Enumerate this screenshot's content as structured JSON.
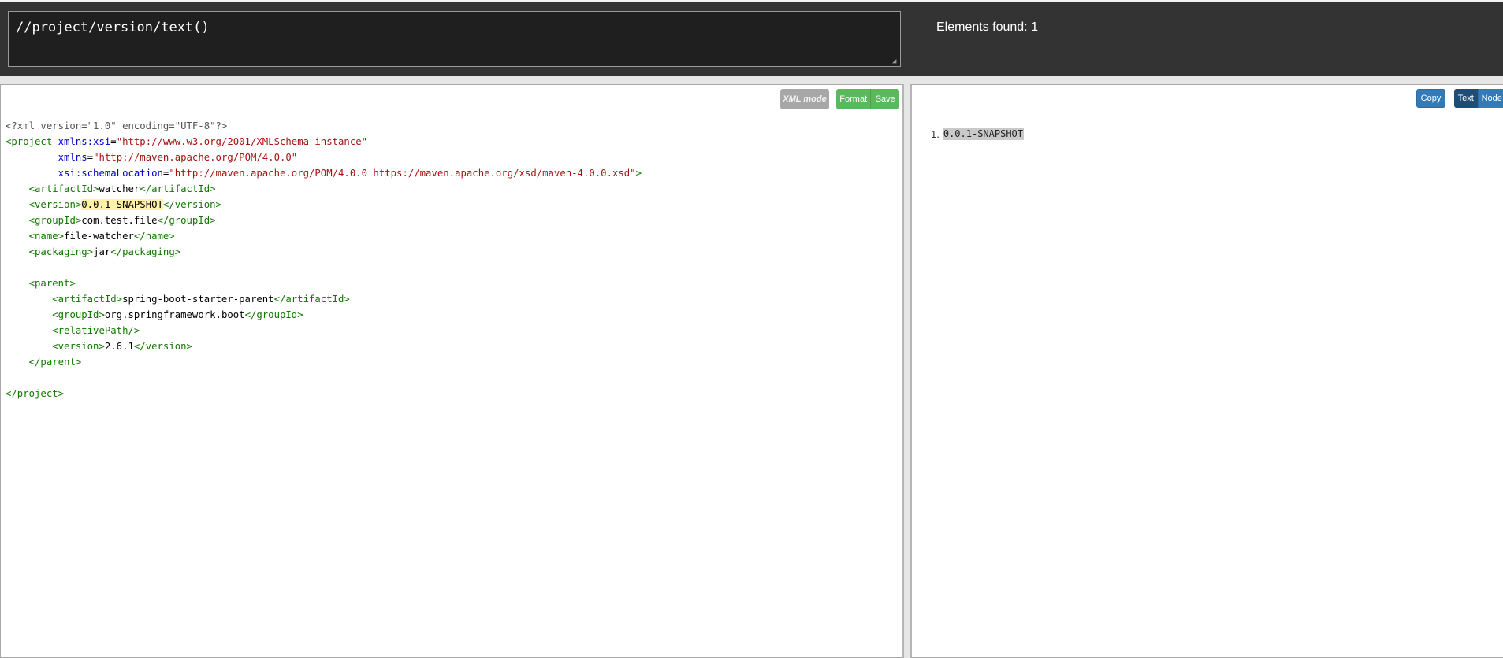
{
  "xpath": {
    "query": "//project/version/text()",
    "results_count_label": "Elements found: 1"
  },
  "editor": {
    "toolbar": {
      "xml_mode_label": "XML mode",
      "format_label": "Format",
      "save_label": "Save"
    },
    "lines": {
      "l1": {
        "decl": "<?xml version=\"1.0\" encoding=\"UTF-8\"?>"
      },
      "l2": {
        "tag": "<project",
        "attr": "xmlns:xsi",
        "eq": "=",
        "val": "\"http://www.w3.org/2001/XMLSchema-instance\""
      },
      "l3": {
        "attr": "xmlns",
        "eq": "=",
        "val": "\"http://maven.apache.org/POM/4.0.0\""
      },
      "l4": {
        "attr": "xsi:schemaLocation",
        "eq": "=",
        "val": "\"http://maven.apache.org/POM/4.0.0 https://maven.apache.org/xsd/maven-4.0.0.xsd\"",
        "close": ">"
      },
      "l5": {
        "open": "<artifactId>",
        "text": "watcher",
        "close": "</artifactId>"
      },
      "l6": {
        "open": "<version>",
        "text": "0.0.1-SNAPSHOT",
        "close": "</version>"
      },
      "l7": {
        "open": "<groupId>",
        "text": "com.test.file",
        "close": "</groupId>"
      },
      "l8": {
        "open": "<name>",
        "text": "file-watcher",
        "close": "</name>"
      },
      "l9": {
        "open": "<packaging>",
        "text": "jar",
        "close": "</packaging>"
      },
      "l11": {
        "open": "<parent>"
      },
      "l12": {
        "open": "<artifactId>",
        "text": "spring-boot-starter-parent",
        "close": "</artifactId>"
      },
      "l13": {
        "open": "<groupId>",
        "text": "org.springframework.boot",
        "close": "</groupId>"
      },
      "l14": {
        "open": "<relativePath/>"
      },
      "l15": {
        "open": "<version>",
        "text": "2.6.1",
        "close": "</version>"
      },
      "l16": {
        "close": "</parent>"
      },
      "l18": {
        "close": "</project>"
      }
    }
  },
  "results": {
    "toolbar": {
      "copy_label": "Copy",
      "text_label": "Text",
      "node_label": "Node"
    },
    "items": [
      {
        "index": "1.",
        "value": "0.0.1-SNAPSHOT"
      }
    ]
  }
}
